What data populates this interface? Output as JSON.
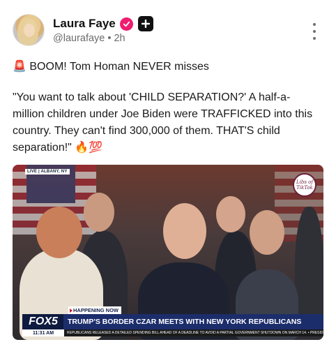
{
  "post": {
    "display_name": "Laura Faye",
    "handle": "@laurafaye",
    "separator": "•",
    "time": "2h",
    "siren_emoji": "🚨",
    "line1": "BOOM! Tom Homan NEVER misses",
    "quote": "\"You want to talk about 'CHILD SEPARATION?' A half-a-million children under Joe Biden were TRAFFICKED into this country. They can't find 300,000 of them. THAT'S child separation!\"",
    "trailing_emojis": "🔥💯",
    "icons": [
      "verified-icon",
      "plus-icon",
      "more-icon"
    ],
    "colors": {
      "verified": "#ee1d6f",
      "plus_badge": "#111111",
      "muted": "#6b6b6b"
    }
  },
  "video": {
    "live_tag": "LIVE | ALBANY, NY",
    "watermark": "Libs of TikTok",
    "happening_now": "HAPPENING NOW",
    "headline": "TRUMP'S BORDER CZAR MEETS WITH NEW YORK REPUBLICANS",
    "network": "FOX5",
    "time": "11:31 AM",
    "ticker": "REPUBLICANS RELEASED A DETAILED SPENDING BILL AHEAD OF A DEADLINE TO AVOID A PARTIAL GOVERNMENT SHUTDOWN ON MARCH 14.  •  PRESIDENT TRU"
  }
}
